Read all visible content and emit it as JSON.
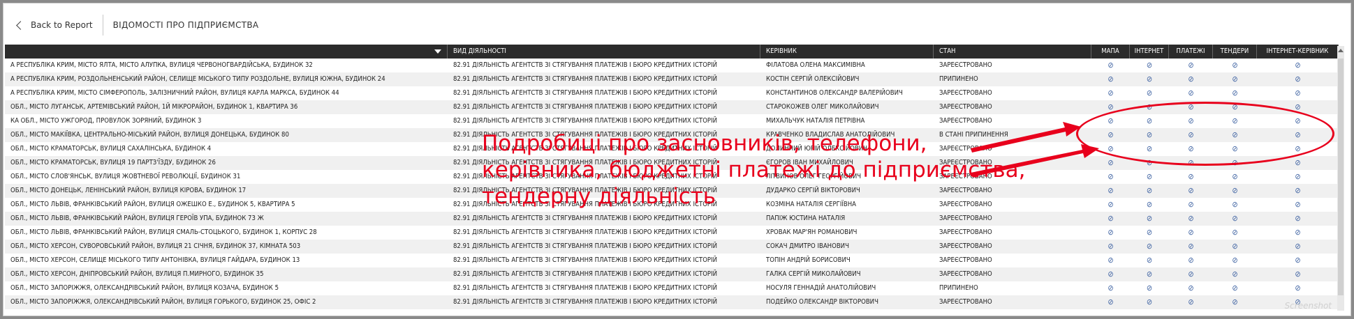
{
  "header": {
    "back_label": "Back to Report",
    "title": "ВІДОМОСТІ ПРО ПІДПРИЄМСТВА"
  },
  "columns": [
    "",
    "ВИД ДІЯЛЬНОСТІ",
    "КЕРІВНИК",
    "СТАН",
    "МАПА",
    "ІНТЕРНЕТ",
    "ПЛАТЕЖІ",
    "ТЕНДЕРИ",
    "ІНТЕРНЕТ-КЕРІВНИК"
  ],
  "icon_glyph": "⊘",
  "rows": [
    {
      "address": "А РЕСПУБЛІКА КРИМ, МІСТО ЯЛТА, МІСТО АЛУПКА, ВУЛИЦЯ ЧЕРВОНОГВАРДІЙСЬКА, БУДИНОК 32",
      "activity": "82.91 ДІЯЛЬНІСТЬ АГЕНТСТВ ЗІ СТЯГУВАННЯ ПЛАТЕЖІВ І БЮРО КРЕДИТНИХ ІСТОРІЙ",
      "director": "ФІЛАТОВА ОЛЕНА МАКСИМІВНА",
      "status": "ЗАРЕЄСТРОВАНО"
    },
    {
      "address": "А РЕСПУБЛІКА КРИМ, РОЗДОЛЬНЕНСЬКИЙ РАЙОН, СЕЛИЩЕ МІСЬКОГО ТИПУ РОЗДОЛЬНЕ, ВУЛИЦЯ ЮЖНА, БУДИНОК 24",
      "activity": "82.91 ДІЯЛЬНІСТЬ АГЕНТСТВ ЗІ СТЯГУВАННЯ ПЛАТЕЖІВ І БЮРО КРЕДИТНИХ ІСТОРІЙ",
      "director": "КОСТІН СЕРГІЙ ОЛЕКСІЙОВИЧ",
      "status": "ПРИПИНЕНО"
    },
    {
      "address": "А РЕСПУБЛІКА КРИМ, МІСТО СІМФЕРОПОЛЬ, ЗАЛІЗНИЧНИЙ РАЙОН, ВУЛИЦЯ КАРЛА МАРКСА, БУДИНОК 44",
      "activity": "82.91 ДІЯЛЬНІСТЬ АГЕНТСТВ ЗІ СТЯГУВАННЯ ПЛАТЕЖІВ І БЮРО КРЕДИТНИХ ІСТОРІЙ",
      "director": "КОНСТАНТИНОВ ОЛЕКСАНДР ВАЛЕРІЙОВИЧ",
      "status": "ЗАРЕЄСТРОВАНО"
    },
    {
      "address": "ОБЛ., МІСТО ЛУГАНСЬК, АРТЕМІВСЬКИЙ РАЙОН, 1Й МІКРОРАЙОН, БУДИНОК 1, КВАРТИРА 36",
      "activity": "82.91 ДІЯЛЬНІСТЬ АГЕНТСТВ ЗІ СТЯГУВАННЯ ПЛАТЕЖІВ І БЮРО КРЕДИТНИХ ІСТОРІЙ",
      "director": "СТАРОКОЖЕВ ОЛЕГ МИКОЛАЙОВИЧ",
      "status": "ЗАРЕЄСТРОВАНО"
    },
    {
      "address": "КА ОБЛ., МІСТО УЖГОРОД, ПРОВУЛОК ЗОРЯНИЙ, БУДИНОК 3",
      "activity": "82.91 ДІЯЛЬНІСТЬ АГЕНТСТВ ЗІ СТЯГУВАННЯ ПЛАТЕЖІВ І БЮРО КРЕДИТНИХ ІСТОРІЙ",
      "director": "МИХАЛЬЧУК НАТАЛІЯ ПЕТРІВНА",
      "status": "ЗАРЕЄСТРОВАНО"
    },
    {
      "address": "ОБЛ., МІСТО МАКІЇВКА, ЦЕНТРАЛЬНО-МІСЬКИЙ РАЙОН, ВУЛИЦЯ ДОНЕЦЬКА, БУДИНОК 80",
      "activity": "82.91 ДІЯЛЬНІСТЬ АГЕНТСТВ ЗІ СТЯГУВАННЯ ПЛАТЕЖІВ І БЮРО КРЕДИТНИХ ІСТОРІЙ",
      "director": "КРАВЧЕНКО ВЛАДИСЛАВ АНАТОЛІЙОВИЧ",
      "status": "В СТАНІ ПРИПИНЕННЯ"
    },
    {
      "address": "ОБЛ., МІСТО КРАМАТОРСЬК, ВУЛИЦЯ САХАЛІНСЬКА, БУДИНОК 4",
      "activity": "82.91 ДІЯЛЬНІСТЬ АГЕНТСТВ ЗІ СТЯГУВАННЯ ПЛАТЕЖІВ І БЮРО КРЕДИТНИХ ІСТОРІЙ",
      "director": "ДОЛИННИЙ ЮРІЙ ОЛЕКСІЙОВИЧ",
      "status": "ЗАРЕЄСТРОВАНО"
    },
    {
      "address": "ОБЛ., МІСТО КРАМАТОРСЬК, ВУЛИЦЯ 19 ПАРТЗ'ЇЗДУ, БУДИНОК 26",
      "activity": "82.91 ДІЯЛЬНІСТЬ АГЕНТСТВ ЗІ СТЯГУВАННЯ ПЛАТЕЖІВ І БЮРО КРЕДИТНИХ ІСТОРІЙ",
      "director": "ЄГОРОВ ІВАН МИХАЙЛОВИЧ",
      "status": "ЗАРЕЄСТРОВАНО"
    },
    {
      "address": "ОБЛ., МІСТО СЛОВ'ЯНСЬК, ВУЛИЦЯ ЖОВТНЕВОЇ РЕВОЛЮЦІЇ, БУДИНОК 31",
      "activity": "82.91 ДІЯЛЬНІСТЬ АГЕНТСТВ ЗІ СТЯГУВАННЯ ПЛАТЕЖІВ І БЮРО КРЕДИТНИХ ІСТОРІЙ",
      "director": "ЛІТВИНОВ ОЛЕГ ГЕОРГІЙОВИЧ",
      "status": "ЗАРЕЄСТРОВАНО"
    },
    {
      "address": "ОБЛ., МІСТО ДОНЕЦЬК, ЛЕНІНСЬКИЙ РАЙОН, ВУЛИЦЯ КІРОВА, БУДИНОК 17",
      "activity": "82.91 ДІЯЛЬНІСТЬ АГЕНТСТВ ЗІ СТЯГУВАННЯ ПЛАТЕЖІВ І БЮРО КРЕДИТНИХ ІСТОРІЙ",
      "director": "ДУДАРКО СЕРГІЙ ВІКТОРОВИЧ",
      "status": "ЗАРЕЄСТРОВАНО"
    },
    {
      "address": "ОБЛ., МІСТО ЛЬВІВ, ФРАНКІВСЬКИЙ РАЙОН, ВУЛИЦЯ ОЖЕШКО Е., БУДИНОК 5, КВАРТИРА 5",
      "activity": "82.91 ДІЯЛЬНІСТЬ АГЕНТСТВ ЗІ СТЯГУВАННЯ ПЛАТЕЖІВ І БЮРО КРЕДИТНИХ ІСТОРІЙ",
      "director": "КОЗМІНА НАТАЛІЯ СЕРГІЇВНА",
      "status": "ЗАРЕЄСТРОВАНО"
    },
    {
      "address": "ОБЛ., МІСТО ЛЬВІВ, ФРАНКІВСЬКИЙ РАЙОН, ВУЛИЦЯ ГЕРОЇВ УПА, БУДИНОК 73 Ж",
      "activity": "82.91 ДІЯЛЬНІСТЬ АГЕНТСТВ ЗІ СТЯГУВАННЯ ПЛАТЕЖІВ І БЮРО КРЕДИТНИХ ІСТОРІЙ",
      "director": "ПАПІЖ ЮСТИНА НАТАЛІЯ",
      "status": "ЗАРЕЄСТРОВАНО"
    },
    {
      "address": "ОБЛ., МІСТО ЛЬВІВ, ФРАНКІВСЬКИЙ РАЙОН, ВУЛИЦЯ СМАЛЬ-СТОЦЬКОГО, БУДИНОК 1, КОРПУС 28",
      "activity": "82.91 ДІЯЛЬНІСТЬ АГЕНТСТВ ЗІ СТЯГУВАННЯ ПЛАТЕЖІВ І БЮРО КРЕДИТНИХ ІСТОРІЙ",
      "director": "ХРОВАК МАР'ЯН РОМАНОВИЧ",
      "status": "ЗАРЕЄСТРОВАНО"
    },
    {
      "address": " ОБЛ., МІСТО ХЕРСОН, СУВОРОВСЬКИЙ РАЙОН, ВУЛИЦЯ 21 СІЧНЯ, БУДИНОК 37, КІМНАТА 503",
      "activity": "82.91 ДІЯЛЬНІСТЬ АГЕНТСТВ ЗІ СТЯГУВАННЯ ПЛАТЕЖІВ І БЮРО КРЕДИТНИХ ІСТОРІЙ",
      "director": "СОКАЧ ДМИТРО ІВАНОВИЧ",
      "status": "ЗАРЕЄСТРОВАНО"
    },
    {
      "address": " ОБЛ., МІСТО ХЕРСОН, СЕЛИЩЕ МІСЬКОГО ТИПУ АНТОНІВКА, ВУЛИЦЯ ГАЙДАРА, БУДИНОК 13",
      "activity": "82.91 ДІЯЛЬНІСТЬ АГЕНТСТВ ЗІ СТЯГУВАННЯ ПЛАТЕЖІВ І БЮРО КРЕДИТНИХ ІСТОРІЙ",
      "director": "ТОПІН АНДРІЙ БОРИСОВИЧ",
      "status": "ЗАРЕЄСТРОВАНО"
    },
    {
      "address": " ОБЛ., МІСТО ХЕРСОН, ДНІПРОВСЬКИЙ РАЙОН, ВУЛИЦЯ П.МИРНОГО, БУДИНОК 35",
      "activity": "82.91 ДІЯЛЬНІСТЬ АГЕНТСТВ ЗІ СТЯГУВАННЯ ПЛАТЕЖІВ І БЮРО КРЕДИТНИХ ІСТОРІЙ",
      "director": "ГАЛКА СЕРГІЙ МИКОЛАЙОВИЧ",
      "status": "ЗАРЕЄСТРОВАНО"
    },
    {
      "address": "ОБЛ., МІСТО ЗАПОРІЖЖЯ, ОЛЕКСАНДРІВСЬКИЙ РАЙОН, ВУЛИЦЯ КОЗАЧА, БУДИНОК 5",
      "activity": "82.91 ДІЯЛЬНІСТЬ АГЕНТСТВ ЗІ СТЯГУВАННЯ ПЛАТЕЖІВ І БЮРО КРЕДИТНИХ ІСТОРІЙ",
      "director": "НОСУЛЯ ГЕННАДІЙ АНАТОЛІЙОВИЧ",
      "status": "ПРИПИНЕНО"
    },
    {
      "address": "ОБЛ., МІСТО ЗАПОРІЖЖЯ, ОЛЕКСАНДРІВСЬКИЙ РАЙОН, ВУЛИЦЯ ГОРЬКОГО, БУДИНОК 25, ОФІС 2",
      "activity": "82.91 ДІЯЛЬНІСТЬ АГЕНТСТВ ЗІ СТЯГУВАННЯ ПЛАТЕЖІВ І БЮРО КРЕДИТНИХ ІСТОРІЙ",
      "director": "ПОДЕЙКО ОЛЕКСАНДР ВІКТОРОВИЧ",
      "status": "ЗАРЕЄСТРОВАНО"
    }
  ],
  "annotation": {
    "lines": [
      "Подробиці про засновників, телефони,",
      "керівника, бюджетні платежі до підприємства,",
      "тендерну діяльність"
    ],
    "color": "#e8001c"
  },
  "watermark": "Screenshot"
}
